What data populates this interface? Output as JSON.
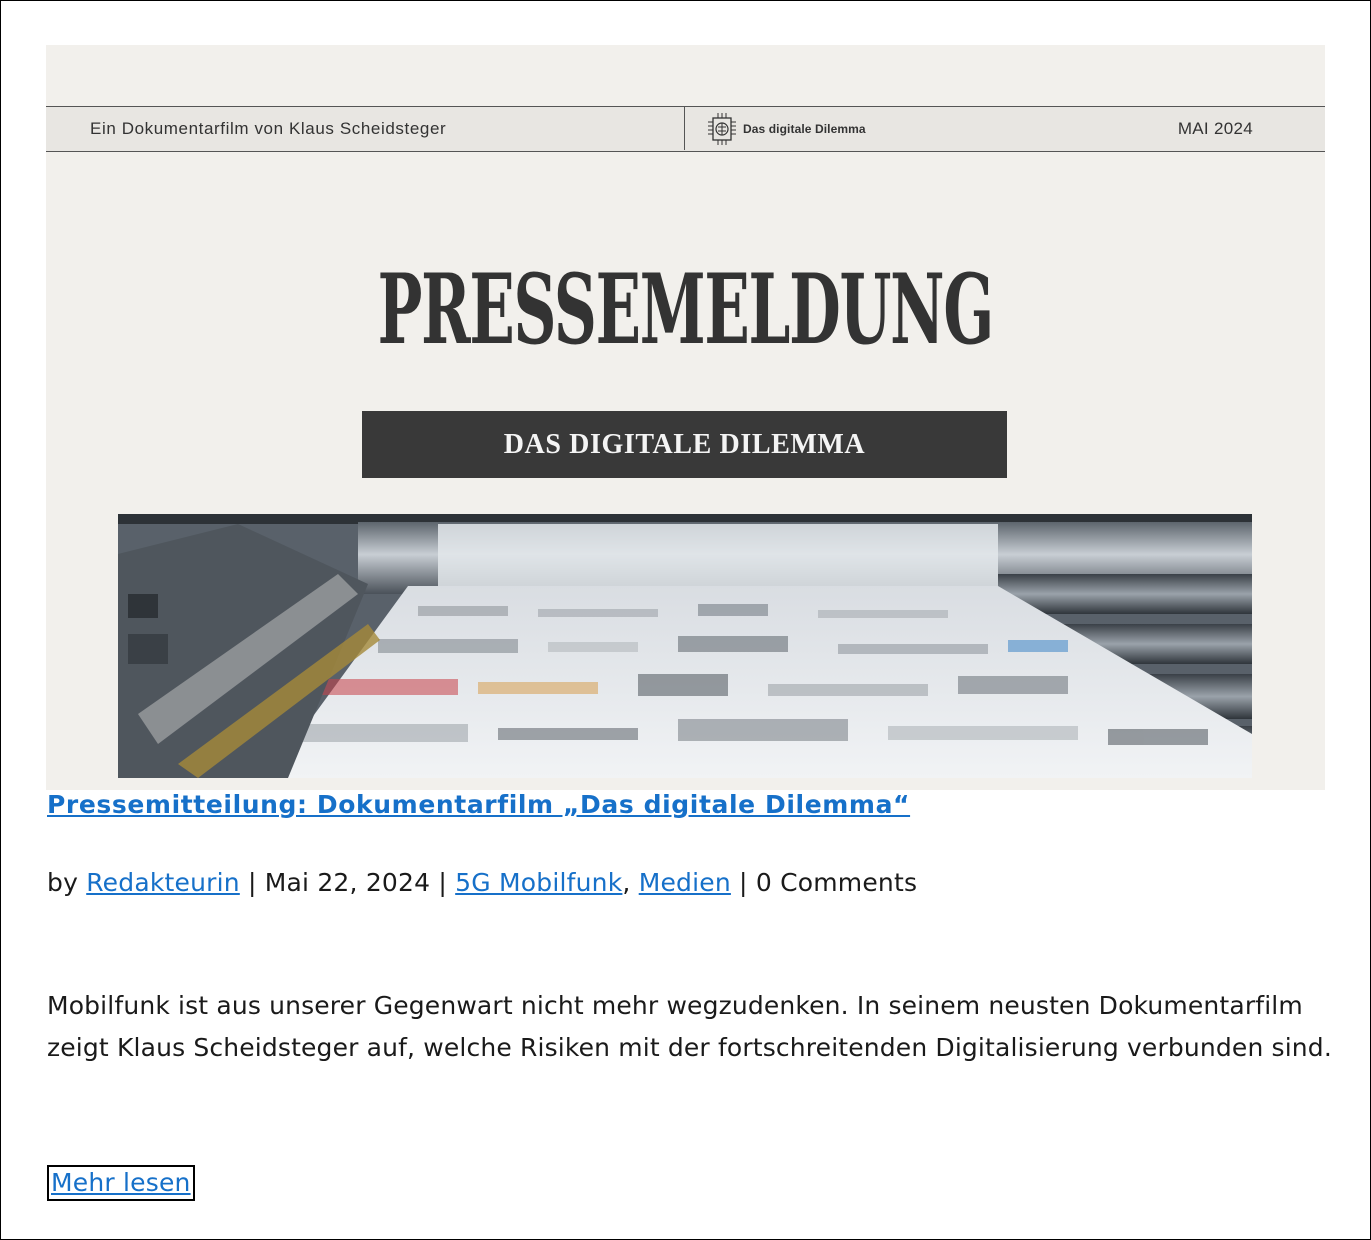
{
  "banner": {
    "filmmaker_line": "Ein Dokumentarfilm von Klaus Scheidsteger",
    "film_logo_text": "Das digitale Dilemma",
    "date_text": "MAI 2024",
    "headline": "PRESSEMELDUNG",
    "subtitle": "DAS DIGITALE DILEMMA",
    "image_icon": "newspaper-printing-press-image"
  },
  "article": {
    "title": "Pressemitteilung: Dokumentarfilm „Das digitale Dilemma“",
    "meta": {
      "by": "by ",
      "author": "Redakteurin",
      "sep1": " | ",
      "date": "Mai 22, 2024",
      "sep2": " | ",
      "category1": "5G Mobilfunk",
      "comma": ", ",
      "category2": "Medien",
      "sep3": " | ",
      "comments": "0 Comments"
    },
    "excerpt": "Mobilfunk ist aus unserer Gegenwart nicht mehr wegzudenken. In seinem neusten Dokumentarfilm zeigt Klaus Scheidsteger auf, welche Risiken mit der fortschreitenden Digitalisierung verbunden sind.",
    "read_more": "Mehr lesen"
  },
  "colors": {
    "link": "#1670c9",
    "banner_bg": "#f2f0ec",
    "subtitle_box": "#393939"
  }
}
